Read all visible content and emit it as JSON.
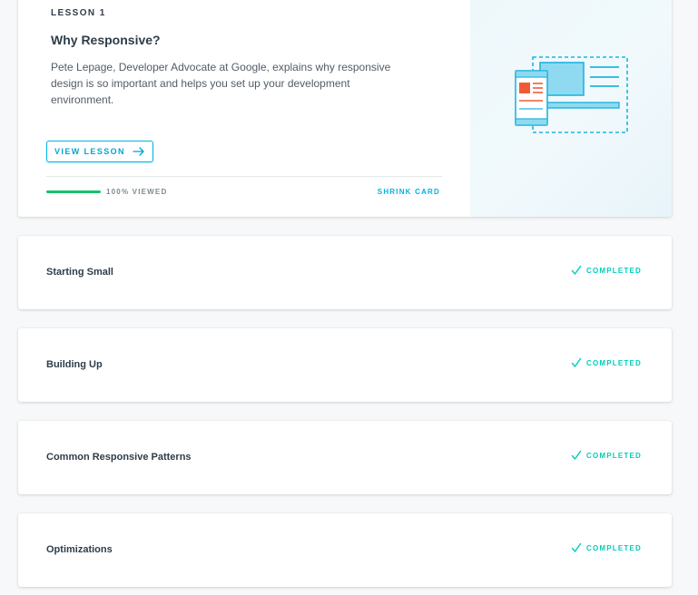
{
  "hero": {
    "lesson_label": "LESSON 1",
    "title": "Why Responsive?",
    "description": "Pete Lepage, Developer Advocate at Google, explains why responsive design is so important and helps you set up your development environment.",
    "view_button_label": "VIEW LESSON",
    "progress_fraction": 1.0,
    "progress_label": "100% VIEWED",
    "shrink_label": "SHRINK CARD",
    "illustration_icon": "responsive-devices-illustration"
  },
  "lessons": [
    {
      "title": "Starting Small",
      "status": "COMPLETED",
      "status_icon": "check-icon"
    },
    {
      "title": "Building Up",
      "status": "COMPLETED",
      "status_icon": "check-icon"
    },
    {
      "title": "Common Responsive Patterns",
      "status": "COMPLETED",
      "status_icon": "check-icon"
    },
    {
      "title": "Optimizations",
      "status": "COMPLETED",
      "status_icon": "check-icon"
    }
  ],
  "colors": {
    "accent": "#02b3e4",
    "completed": "#02ccba",
    "progress": "#15c26b",
    "text": "#2e3d49",
    "illustration_orange": "#f15a35"
  }
}
